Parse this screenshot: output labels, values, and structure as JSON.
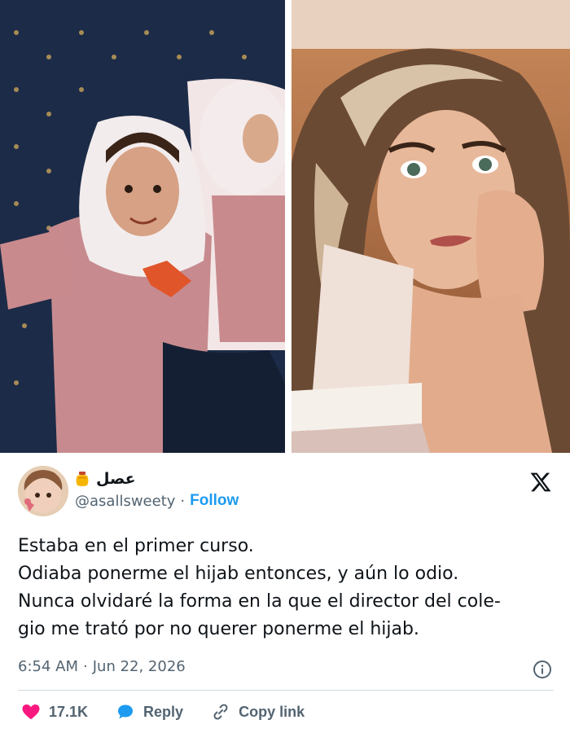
{
  "author": {
    "display_name": "عصل",
    "handle": "@asallsweety",
    "follow_label": "Follow",
    "separator": "·"
  },
  "tweet": {
    "lines": [
      "Estaba en el primer curso.",
      "Odiaba ponerme el hijab entonces, y aún lo odio.",
      "Nunca olvidaré la forma en la que el director del cole-",
      "gio me trató por no querer ponerme el hijab."
    ],
    "time": "6:54 AM",
    "date": "Jun 22, 2026",
    "meta_separator": "·"
  },
  "actions": {
    "likes": "17.1K",
    "reply_label": "Reply",
    "copy_label": "Copy link"
  },
  "colors": {
    "accent": "#1d9bf0",
    "like": "#f91880",
    "text": "#0f1419",
    "muted": "#536471"
  },
  "icons": {
    "brand": "x-logo-icon",
    "info": "info-icon",
    "like": "heart-icon",
    "reply": "reply-bubble-icon",
    "copy": "link-icon",
    "badge": "honey-pot-icon"
  }
}
